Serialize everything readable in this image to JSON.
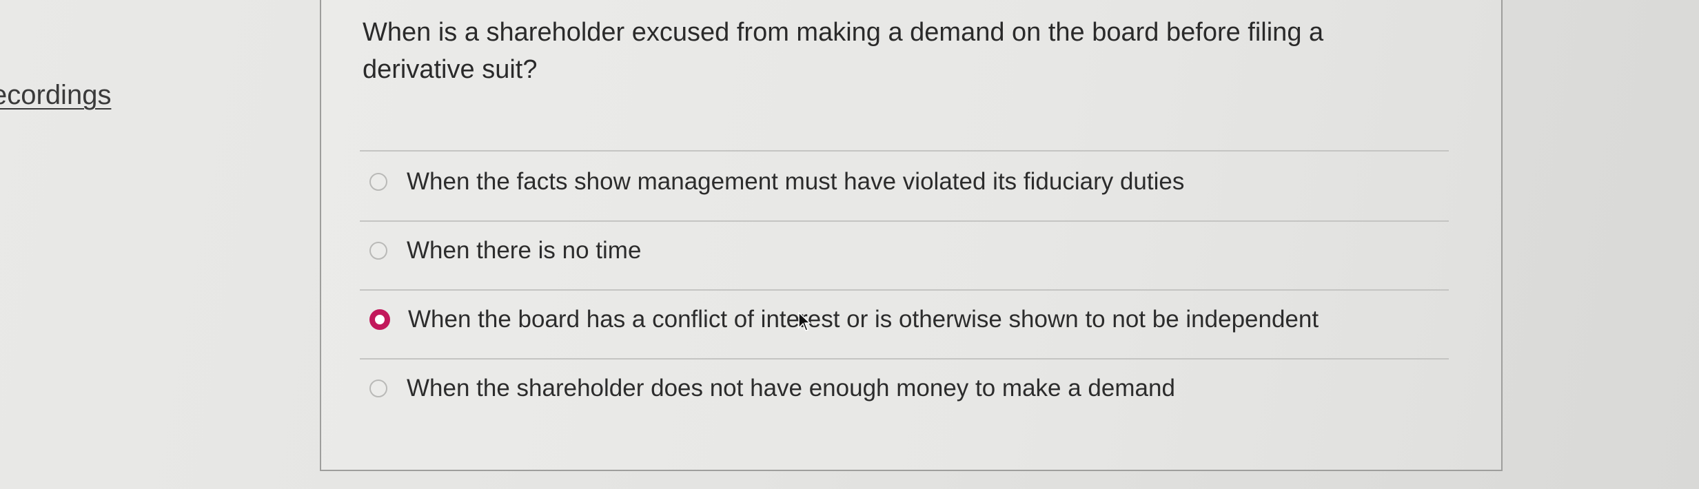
{
  "sidebar": {
    "link_label": "ecordings"
  },
  "question": {
    "text": "When is a shareholder excused from making a demand on the board before filing a derivative suit?"
  },
  "options": [
    {
      "label": "When the facts show management must have violated its fiduciary duties",
      "selected": false
    },
    {
      "label": "When there is no time",
      "selected": false
    },
    {
      "label": "When the board has a conflict of interest or is otherwise shown to not be independent",
      "selected": true
    },
    {
      "label": "When the shareholder does not have enough money to make a demand",
      "selected": false
    }
  ],
  "colors": {
    "selected_radio": "#c2185b",
    "background": "#e6e6e4"
  },
  "icons": {
    "mouse_cursor": "arrow-cursor-icon"
  }
}
